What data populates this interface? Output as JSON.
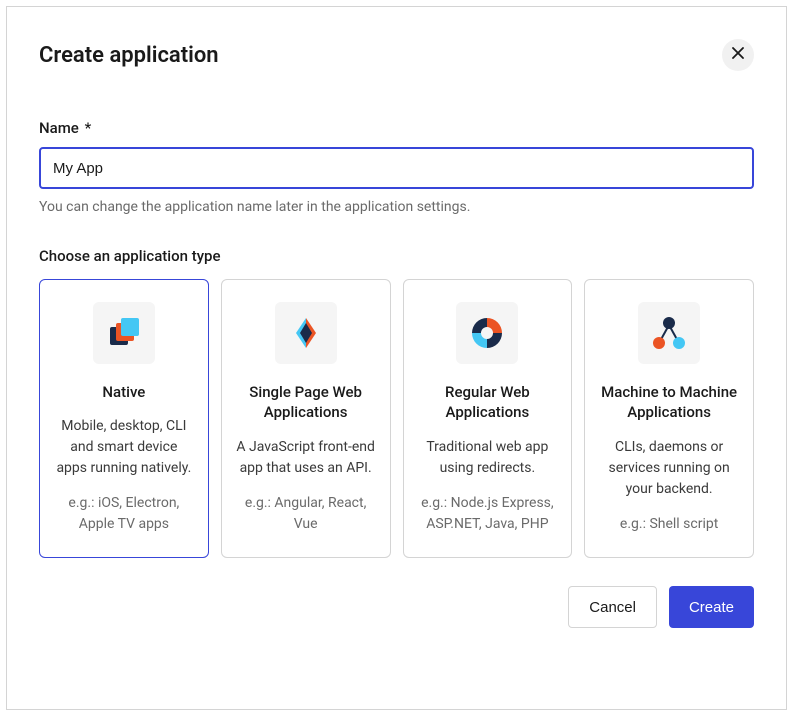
{
  "modal": {
    "title": "Create application",
    "name_label": "Name",
    "required_marker": "*",
    "name_value": "My App",
    "name_help": "You can change the application name later in the application settings.",
    "type_section_label": "Choose an application type",
    "types": [
      {
        "title": "Native",
        "description": "Mobile, desktop, CLI and smart device apps running natively.",
        "example": "e.g.: iOS, Electron, Apple TV apps",
        "selected": true
      },
      {
        "title": "Single Page Web Applications",
        "description": "A JavaScript front-end app that uses an API.",
        "example": "e.g.: Angular, React, Vue",
        "selected": false
      },
      {
        "title": "Regular Web Applications",
        "description": "Traditional web app using redirects.",
        "example": "e.g.: Node.js Express, ASP.NET, Java, PHP",
        "selected": false
      },
      {
        "title": "Machine to Machine Applications",
        "description": "CLIs, daemons or services running on your backend.",
        "example": "e.g.: Shell script",
        "selected": false
      }
    ],
    "cancel_label": "Cancel",
    "create_label": "Create"
  }
}
